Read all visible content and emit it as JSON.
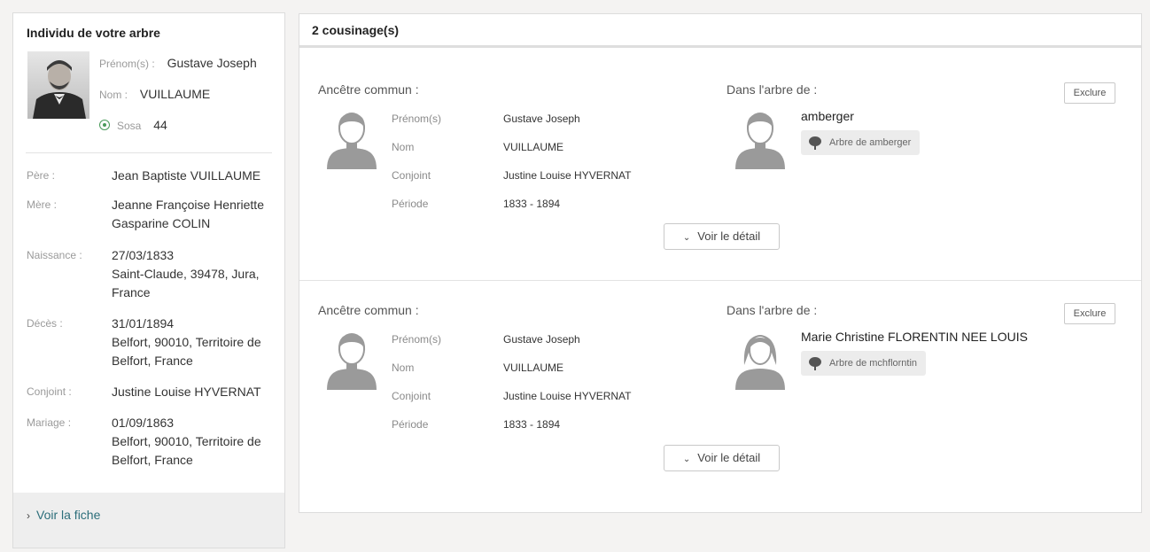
{
  "person": {
    "panel_title": "Individu de votre arbre",
    "prenom_label": "Prénom(s) :",
    "prenom": "Gustave Joseph",
    "nom_label": "Nom :",
    "nom": "VUILLAUME",
    "sosa_label": "Sosa",
    "sosa": "44",
    "details": [
      {
        "label": "Père :",
        "value": "Jean Baptiste VUILLAUME"
      },
      {
        "label": "Mère :",
        "value": "Jeanne Françoise Henriette Gasparine COLIN"
      },
      {
        "label": "Naissance :",
        "value_lines": [
          "27/03/1833",
          "Saint-Claude, 39478, Jura, France"
        ]
      },
      {
        "label": "Décès :",
        "value_lines": [
          "31/01/1894",
          "Belfort, 90010, Territoire de Belfort, France"
        ]
      },
      {
        "label": "Conjoint :",
        "value": "Justine Louise HYVERNAT"
      },
      {
        "label": "Mariage :",
        "value_lines": [
          "01/09/1863",
          "Belfort, 90010, Territoire de Belfort, France"
        ]
      }
    ],
    "footer_link": "Voir la fiche"
  },
  "cousinages": {
    "header": "2 cousinage(s)",
    "common_heading": "Ancêtre commun :",
    "tree_heading": "Dans l'arbre de :",
    "exclude_label": "Exclure",
    "detail_label": "Voir le détail",
    "field_labels": {
      "prenom": "Prénom(s)",
      "nom": "Nom",
      "conjoint": "Conjoint",
      "periode": "Période"
    },
    "items": [
      {
        "ancestor": {
          "prenom": "Gustave Joseph",
          "nom": "VUILLAUME",
          "conjoint": "Justine Louise HYVERNAT",
          "periode": "1833 - 1894"
        },
        "tree_owner": "amberger",
        "tree_label": "Arbre de amberger",
        "owner_gender": "male"
      },
      {
        "ancestor": {
          "prenom": "Gustave Joseph",
          "nom": "VUILLAUME",
          "conjoint": "Justine Louise HYVERNAT",
          "periode": "1833 - 1894"
        },
        "tree_owner": "Marie Christine FLORENTIN NEE LOUIS",
        "tree_label": "Arbre de mchflorntin",
        "owner_gender": "female"
      }
    ]
  },
  "colors": {
    "accent": "#4a9a5a",
    "link": "#2c6e7a",
    "avatar": "#9a9a9a"
  }
}
